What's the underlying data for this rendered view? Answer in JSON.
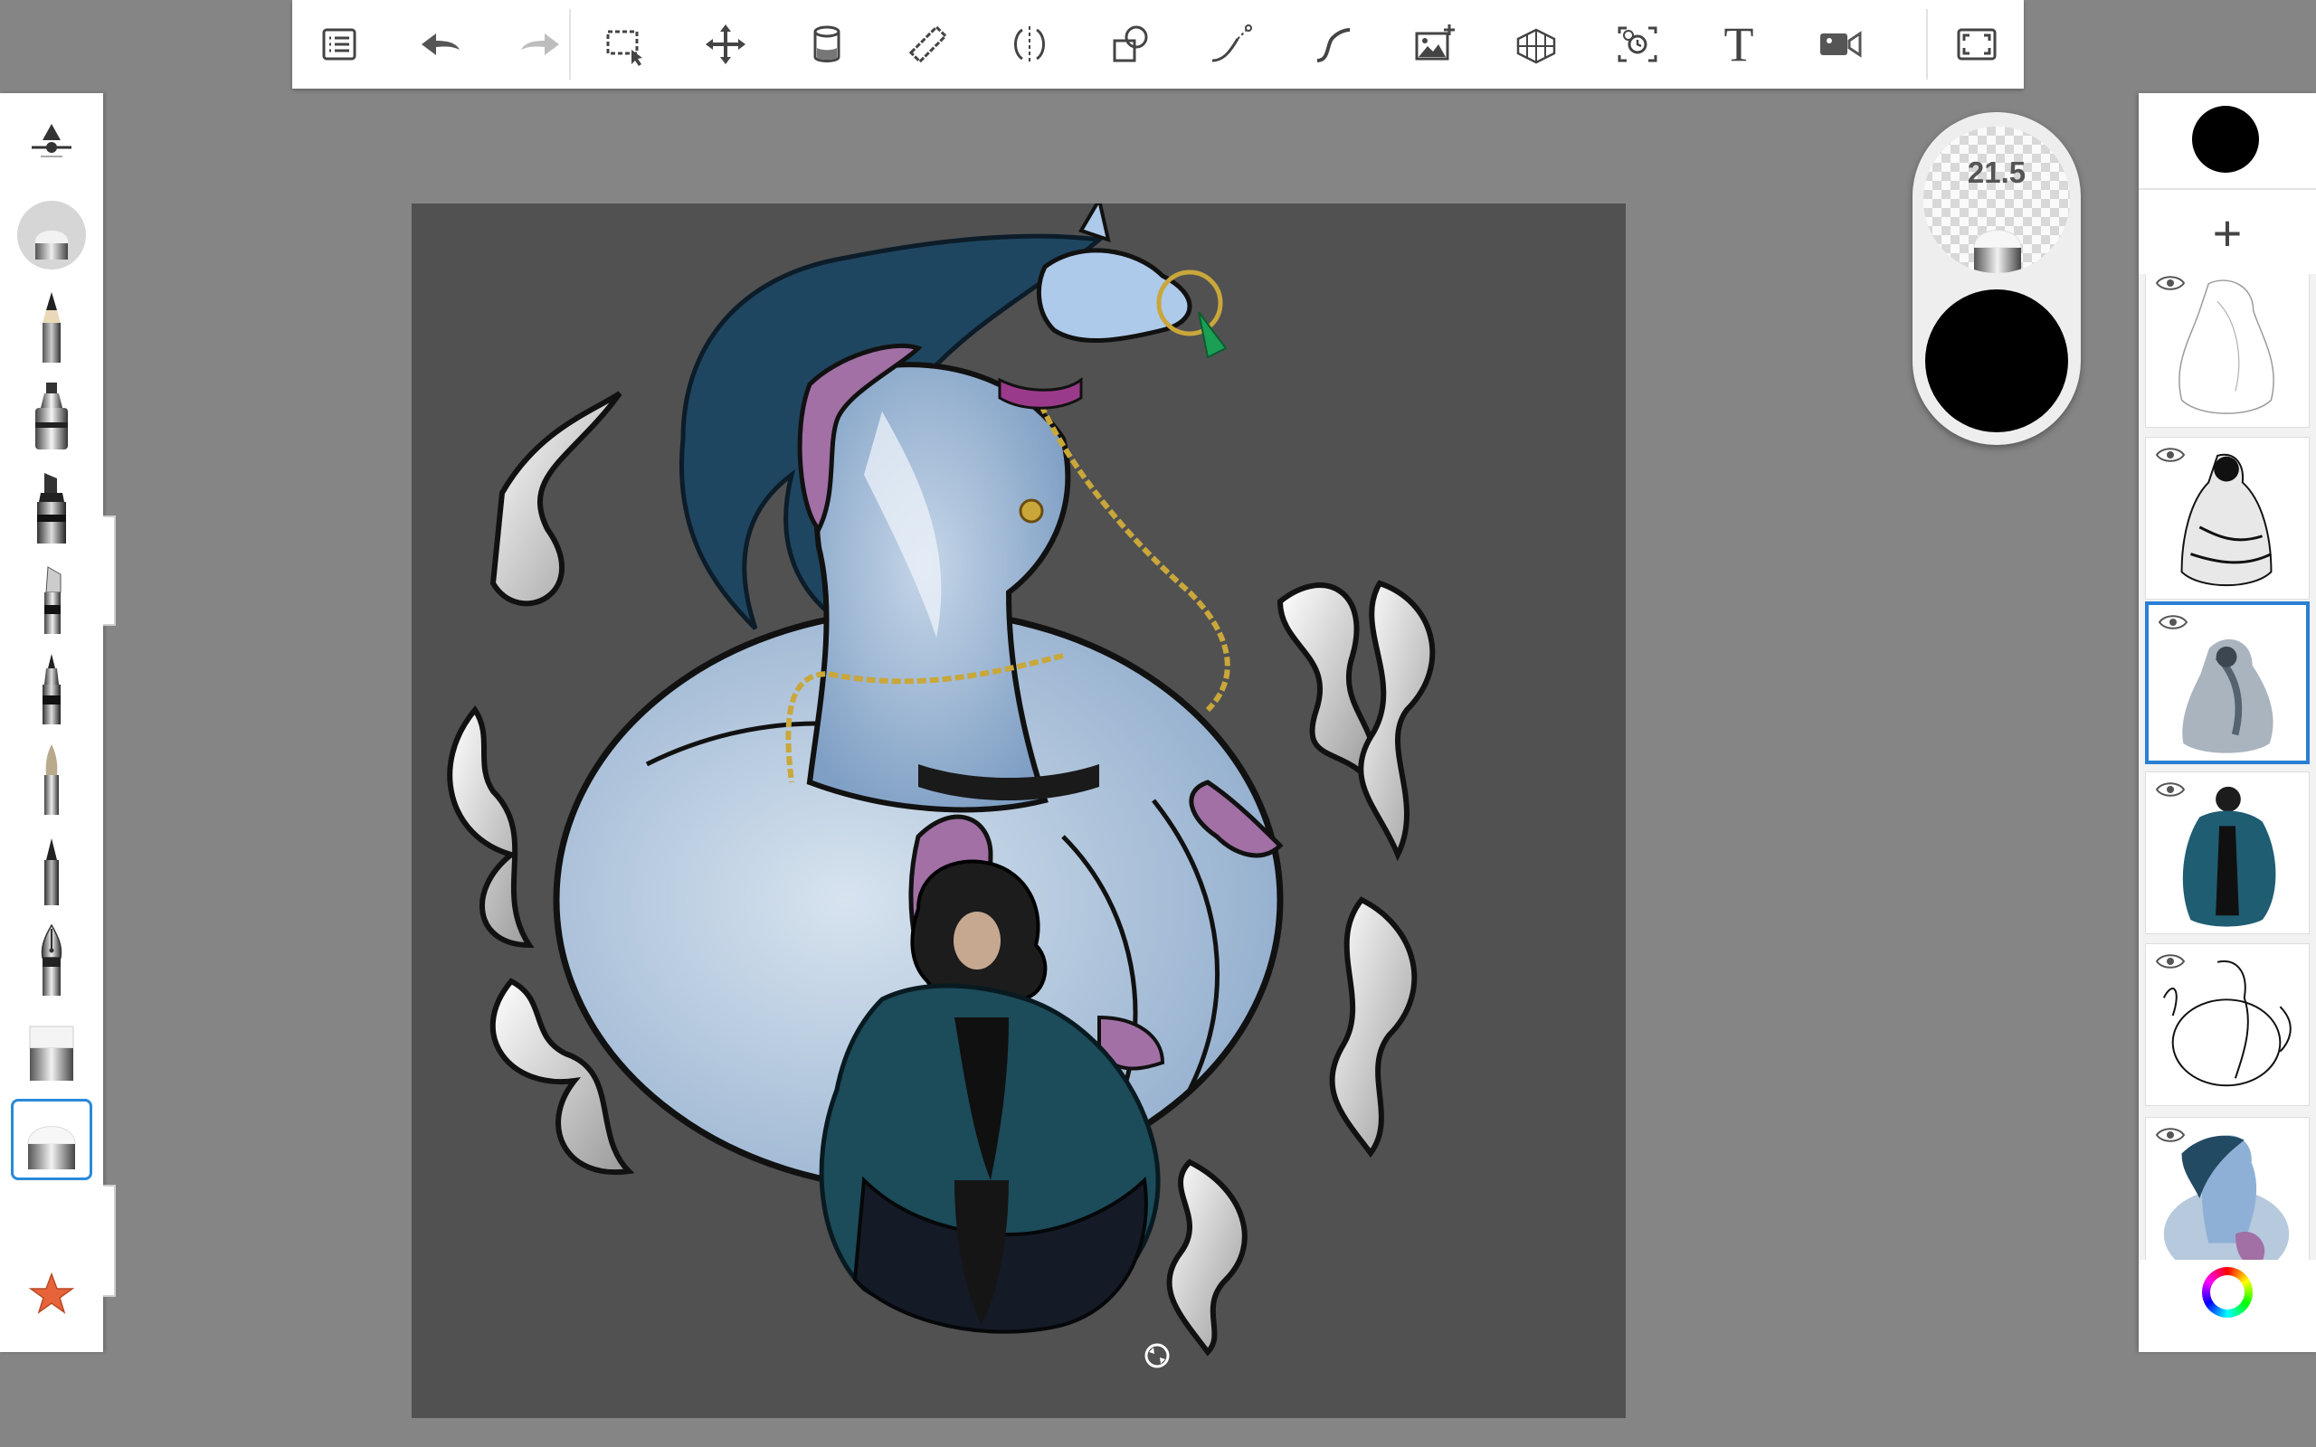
{
  "toolbar": {
    "items": [
      {
        "name": "layers-menu",
        "icon": "list-icon"
      },
      {
        "name": "undo",
        "icon": "undo-arrow-icon"
      },
      {
        "name": "redo",
        "icon": "redo-arrow-icon"
      },
      {
        "name": "selection",
        "icon": "marquee-select-icon"
      },
      {
        "name": "transform",
        "icon": "move-arrows-icon"
      },
      {
        "name": "fill",
        "icon": "paint-bucket-icon"
      },
      {
        "name": "ruler",
        "icon": "ruler-icon"
      },
      {
        "name": "symmetry",
        "icon": "symmetry-icon"
      },
      {
        "name": "shapes",
        "icon": "shapes-icon"
      },
      {
        "name": "stroke",
        "icon": "curve-stroke-icon"
      },
      {
        "name": "predictive-stroke",
        "icon": "s-curve-icon"
      },
      {
        "name": "import-image",
        "icon": "add-image-icon"
      },
      {
        "name": "perspective",
        "icon": "perspective-grid-icon"
      },
      {
        "name": "time-lapse",
        "icon": "time-lapse-icon"
      },
      {
        "name": "text",
        "icon": "text-icon",
        "label": "T"
      },
      {
        "name": "record",
        "icon": "video-camera-icon"
      },
      {
        "name": "fullscreen",
        "icon": "fullscreen-icon"
      }
    ]
  },
  "brushes": {
    "selected_index": 11,
    "items": [
      {
        "name": "brush-properties",
        "icon": "brush-properties-icon"
      },
      {
        "name": "soft-eraser-preview",
        "icon": "soft-eraser-icon"
      },
      {
        "name": "pencil",
        "icon": "pencil-icon"
      },
      {
        "name": "airbrush",
        "icon": "airbrush-icon"
      },
      {
        "name": "marker",
        "icon": "marker-icon"
      },
      {
        "name": "chisel",
        "icon": "chisel-icon"
      },
      {
        "name": "ballpoint-pen",
        "icon": "ballpoint-pen-icon"
      },
      {
        "name": "paint-brush",
        "icon": "paint-brush-icon"
      },
      {
        "name": "fine-pen",
        "icon": "fine-pen-icon"
      },
      {
        "name": "fountain-pen",
        "icon": "fountain-pen-icon"
      },
      {
        "name": "hard-eraser",
        "icon": "hard-eraser-icon"
      },
      {
        "name": "soft-eraser",
        "icon": "soft-eraser-icon"
      },
      {
        "name": "favorites",
        "icon": "star-icon"
      }
    ]
  },
  "puck": {
    "size_label": "21.5",
    "opacity_color": "#000000"
  },
  "layers": {
    "current_color": "#000000",
    "add_label": "+",
    "selected_index": 2,
    "items": [
      {
        "name": "layer-sketch",
        "visible": true
      },
      {
        "name": "layer-ink-dark",
        "visible": true
      },
      {
        "name": "layer-shading",
        "visible": true
      },
      {
        "name": "layer-color-character",
        "visible": true
      },
      {
        "name": "layer-lineart",
        "visible": true
      },
      {
        "name": "layer-color-full",
        "visible": true
      }
    ]
  },
  "colors": {
    "accent": "#2a8ad8",
    "canvas_bg": "#515151",
    "workspace_bg": "#858585",
    "panel_bg": "#ffffff"
  }
}
